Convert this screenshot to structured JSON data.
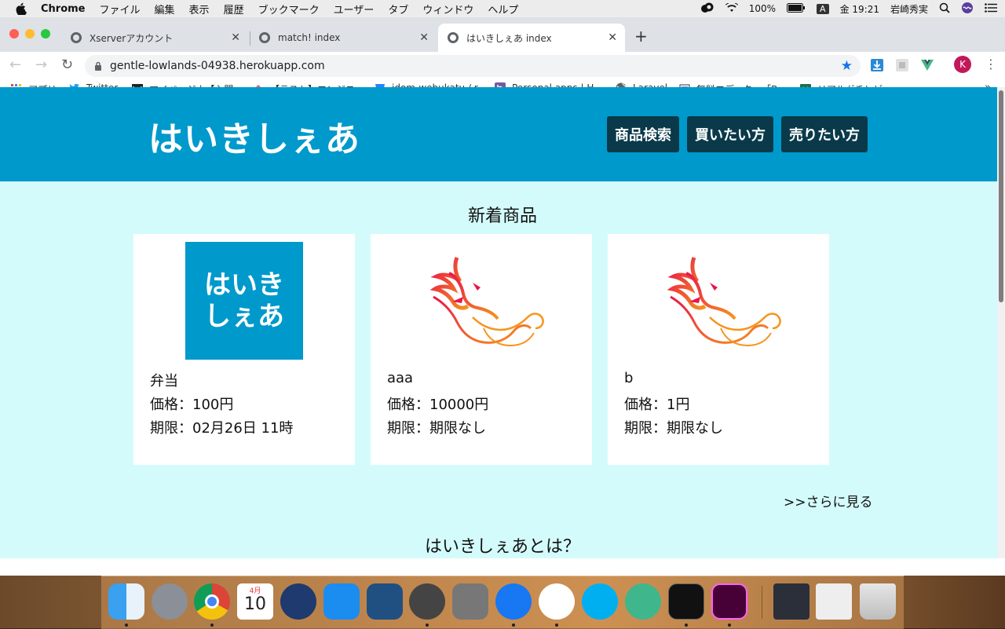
{
  "menubar": {
    "app_name": "Chrome",
    "items": [
      "ファイル",
      "編集",
      "表示",
      "履歴",
      "ブックマーク",
      "ユーザー",
      "タブ",
      "ウィンドウ",
      "ヘルプ"
    ],
    "battery": "100%",
    "input_mode": "A",
    "clock": "金 19:21",
    "user": "岩崎秀実"
  },
  "browser": {
    "tabs": [
      {
        "title": "Xserverアカウント",
        "active": false
      },
      {
        "title": "match! index",
        "active": false
      },
      {
        "title": "はいきしぇあ index",
        "active": true
      }
    ],
    "url": "gentle-lowlands-04938.herokuapp.com",
    "profile_initial": "K",
    "bookmarks": [
      {
        "label": "アプリ",
        "icon": "apps-grid-icon"
      },
      {
        "label": "Twitter",
        "icon": "twitter-icon"
      },
      {
        "label": "マイページ | 【入門…",
        "icon": "w-logo-icon"
      },
      {
        "label": "【テスト】エンジニ…",
        "icon": "asana-icon"
      },
      {
        "label": "idom-webukatu / r…",
        "icon": "bitbucket-icon"
      },
      {
        "label": "Personal apps | H…",
        "icon": "heroku-icon"
      },
      {
        "label": "Laravel",
        "icon": "globe-icon"
      },
      {
        "label": "無料エディター「Br…",
        "icon": "editor-icon"
      },
      {
        "label": "リアルガチレビュー…",
        "icon": "excel-icon"
      }
    ],
    "bookmarks_more": "»"
  },
  "site": {
    "logo": "はいきしぇあ",
    "nav": [
      "商品検索",
      "買いたい方",
      "売りたい方"
    ],
    "new_items_title": "新着商品",
    "items": [
      {
        "name": "弁当",
        "price": "価格：100円",
        "deadline": "期限：02月26日 11時",
        "image": "logo-thumbnail",
        "logo_line1": "はいき",
        "logo_line2": "しぇあ"
      },
      {
        "name": "aaa",
        "price": "価格：10000円",
        "deadline": "期限：期限なし",
        "image": "phoenix-image"
      },
      {
        "name": "b",
        "price": "価格：1円",
        "deadline": "期限：期限なし",
        "image": "phoenix-image"
      }
    ],
    "more_link": ">>さらに見る",
    "about_title": "はいきしぇあとは？"
  },
  "dock": {
    "calendar_month": "4月",
    "calendar_day": "10",
    "apps": [
      "finder-icon",
      "launchpad-icon",
      "chrome-icon",
      "calendar-icon",
      "quicktime-icon",
      "app-store-icon",
      "sourcetree-icon",
      "sequel-pro-icon",
      "system-preferences-icon",
      "maps-pin-icon",
      "slack-icon",
      "skype-icon",
      "atom-icon",
      "terminal-icon",
      "adobe-xd-icon",
      "screenshot-thumb-1",
      "screenshot-thumb-2",
      "trash-icon"
    ]
  },
  "colors": {
    "header_bg": "#0099cc",
    "page_bg": "#d4fbfb",
    "nav_button_bg": "#0a3a4a"
  }
}
